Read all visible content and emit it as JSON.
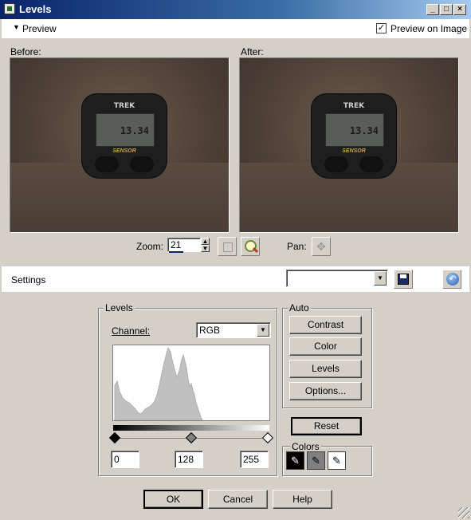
{
  "window": {
    "title": "Levels",
    "min_btn": "_",
    "max_btn": "□",
    "close_btn": "×"
  },
  "preview": {
    "toggle_label": "Preview",
    "preview_on_image_label": "Preview on Image",
    "preview_on_image_checked": true
  },
  "panels": {
    "before_label": "Before:",
    "after_label": "After:"
  },
  "zoom": {
    "label": "Zoom:",
    "value": "21",
    "pan_label": "Pan:"
  },
  "device": {
    "brand": "TREK",
    "digits": "13.34",
    "sensor": "SENSOR"
  },
  "settings": {
    "label": "Settings",
    "preset_value": ""
  },
  "levels": {
    "group_label": "Levels",
    "channel_label": "Channel:",
    "channel_value": "RGB",
    "input_black": "0",
    "input_gamma": "128",
    "input_white": "255"
  },
  "auto": {
    "group_label": "Auto",
    "contrast": "Contrast",
    "color": "Color",
    "levels": "Levels",
    "options": "Options..."
  },
  "reset_label": "Reset",
  "colors": {
    "group_label": "Colors"
  },
  "footer": {
    "ok": "OK",
    "cancel": "Cancel",
    "help": "Help"
  }
}
